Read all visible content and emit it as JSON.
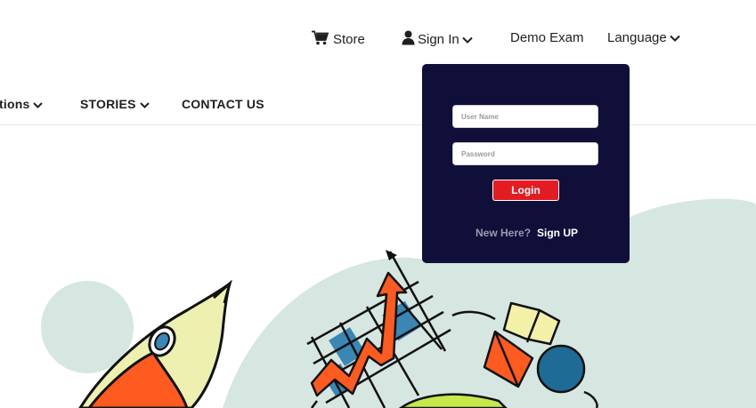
{
  "topbar": {
    "store_label": "Store",
    "signin_label": "Sign In",
    "demo_label": "Demo Exam",
    "language_label": "Language"
  },
  "nav": {
    "partial_label": "tions",
    "stories_label": "STORIES",
    "contact_label": "CONTACT US"
  },
  "login": {
    "username_placeholder": "User Name",
    "password_placeholder": "Password",
    "button_label": "Login",
    "new_here_text": "New Here?",
    "signup_label": "Sign UP"
  },
  "colors": {
    "panel_bg": "#0f0f3a",
    "login_button": "#e31b23",
    "hero_blob": "#d6e6e0",
    "rocket_body": "#eef0b0",
    "rocket_flame": "#ff5a1f",
    "chart_blue": "#3a86b4",
    "circle_blue": "#1e6b96"
  }
}
